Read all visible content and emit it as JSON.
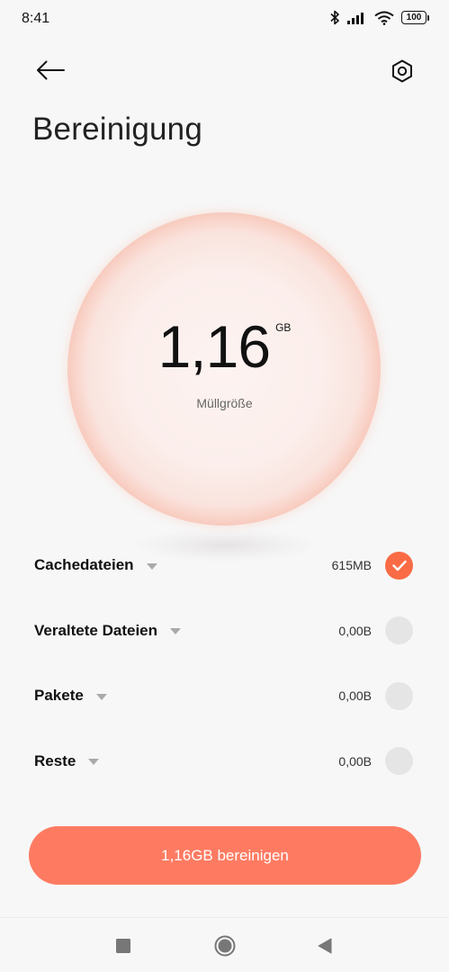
{
  "status_bar": {
    "time": "8:41",
    "battery": "100",
    "icons": [
      "bluetooth-icon",
      "signal-icon",
      "wifi-icon",
      "battery-icon"
    ]
  },
  "header": {
    "back_icon": "arrow-left-icon",
    "settings_icon": "settings-hexagon-icon",
    "title": "Bereinigung"
  },
  "summary": {
    "value": "1,16",
    "unit": "GB",
    "label": "Müllgröße"
  },
  "items": [
    {
      "label": "Cachedateien",
      "size": "615MB",
      "checked": true
    },
    {
      "label": "Veraltete Dateien",
      "size": "0,00B",
      "checked": false
    },
    {
      "label": "Pakete",
      "size": "0,00B",
      "checked": false
    },
    {
      "label": "Reste",
      "size": "0,00B",
      "checked": false
    }
  ],
  "action": {
    "label": "1,16GB bereinigen"
  },
  "nav": {
    "icons": [
      "recents-square-icon",
      "home-circle-icon",
      "back-triangle-icon"
    ]
  },
  "colors": {
    "accent": "#fe7b62",
    "check": "#f96b45",
    "background": "#f7f7f7"
  }
}
